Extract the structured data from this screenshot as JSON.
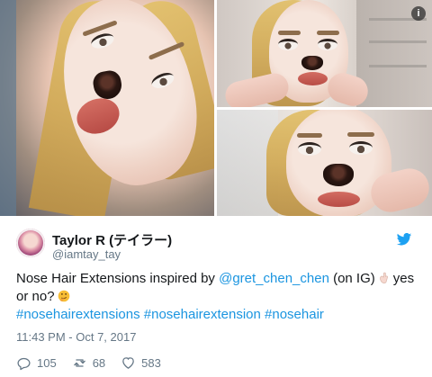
{
  "media": {
    "info_label": "i"
  },
  "author": {
    "name": "Taylor R (テイラー)",
    "handle": "@iamtay_tay"
  },
  "tweet": {
    "text_prefix": "Nose Hair Extensions inspired by ",
    "mention": "@gret_chen_chen",
    "text_after_mention": " (on IG)",
    "text_after_emoji": "yes",
    "line2_start": "or no?",
    "hashtags": "#nosehairextensions #nosehairextension #nosehair",
    "timestamp": "11:43 PM - Oct 7, 2017"
  },
  "actions": {
    "replies": "105",
    "retweets": "68",
    "likes": "583"
  },
  "colors": {
    "link": "#1b95e0",
    "secondary_text": "#657786",
    "twitter_blue": "#1da1f2"
  }
}
